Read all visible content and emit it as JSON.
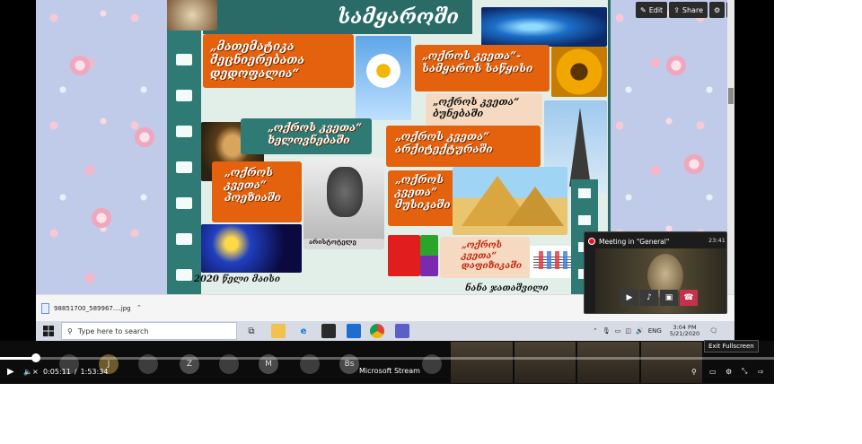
{
  "slide": {
    "title_partial": "სამყაროში",
    "tiles": [
      {
        "text": "„მათემატიკა\nმეცნიერებათა\nდედოფალია“"
      },
      {
        "text": "„ოქროს კვეთა“-\nსამყაროს საწყისი"
      },
      {
        "text": "„ოქროს კვეთა“\nბუნებაში"
      },
      {
        "text": "„ოქროს კვეთა“\nხელოვნებაში"
      },
      {
        "text": "„ოქროს კვეთა“\nარქიტექტურაში"
      },
      {
        "text": "„ოქროს\nკვეთა“\nპოეზიაში"
      },
      {
        "text": "„ოქროს\nკვეთა“\nმუსიკაში"
      },
      {
        "text": "„ოქროს\nკვეთა“\nდაფიზიკაში"
      }
    ],
    "portrait_caption": "არისტოტელე",
    "footer_year": "2020 წელი მაისი",
    "footer_author": "ნანა ჯათაშვილი"
  },
  "slide_toolbar": {
    "edit_label": "Edit",
    "share_label": "Share"
  },
  "download_bar": {
    "file_name": "98851700_589967....jpg"
  },
  "taskbar": {
    "search_placeholder": "Type here to search",
    "language": "ENG",
    "time": "3:04 PM",
    "date": "5/21/2020"
  },
  "meeting": {
    "title": "Meeting in \"General\"",
    "timer": "23:41"
  },
  "stream": {
    "current_time": "0:05:11",
    "separator": "/",
    "duration": "1:53:34",
    "progress": 0.046,
    "label": "Microsoft Stream",
    "tooltip": "Exit Fullscreen",
    "participants": [
      "J",
      "Z",
      "M",
      "Bs"
    ]
  },
  "colors": {
    "slide_teal": "#2f7a74",
    "tile_orange": "#e4620e",
    "end_call_red": "#c4314b"
  }
}
